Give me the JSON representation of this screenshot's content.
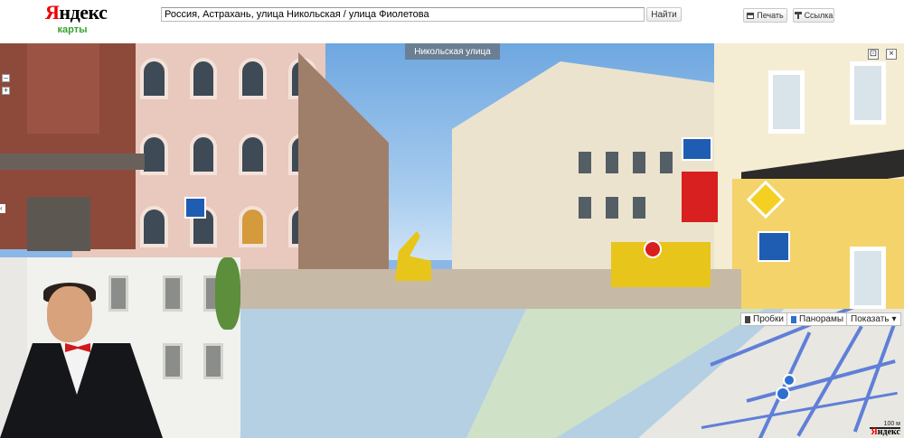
{
  "header": {
    "logo_text_first": "Я",
    "logo_text_rest": "ндекс",
    "logo_sub": "карты",
    "search_value": "Россия, Астрахань, улица Никольская / улица Фиолетова",
    "find_button": "Найти",
    "print_button": "Печать",
    "link_button": "Ссылка",
    "print_icon": "printer-icon",
    "link_icon": "link-icon"
  },
  "panorama": {
    "street_label": "Никольская улица",
    "fullscreen_icon": "expand-icon",
    "close_icon": "close-icon",
    "zoom_out": "–",
    "zoom_in": "+",
    "nav_arrow": "‹"
  },
  "map": {
    "traffic_button": "Пробки",
    "panoramas_button": "Панорамы",
    "show_button": "Показать",
    "scale_label": "100 м",
    "logo_first": "Я",
    "logo_rest": "ндекс"
  },
  "colors": {
    "brand_red": "#e00000",
    "brand_green": "#3aa12f",
    "street_label_bg": "#6a7f93",
    "map_water": "#b5d0e3",
    "map_roads": "#5f7fd8"
  }
}
